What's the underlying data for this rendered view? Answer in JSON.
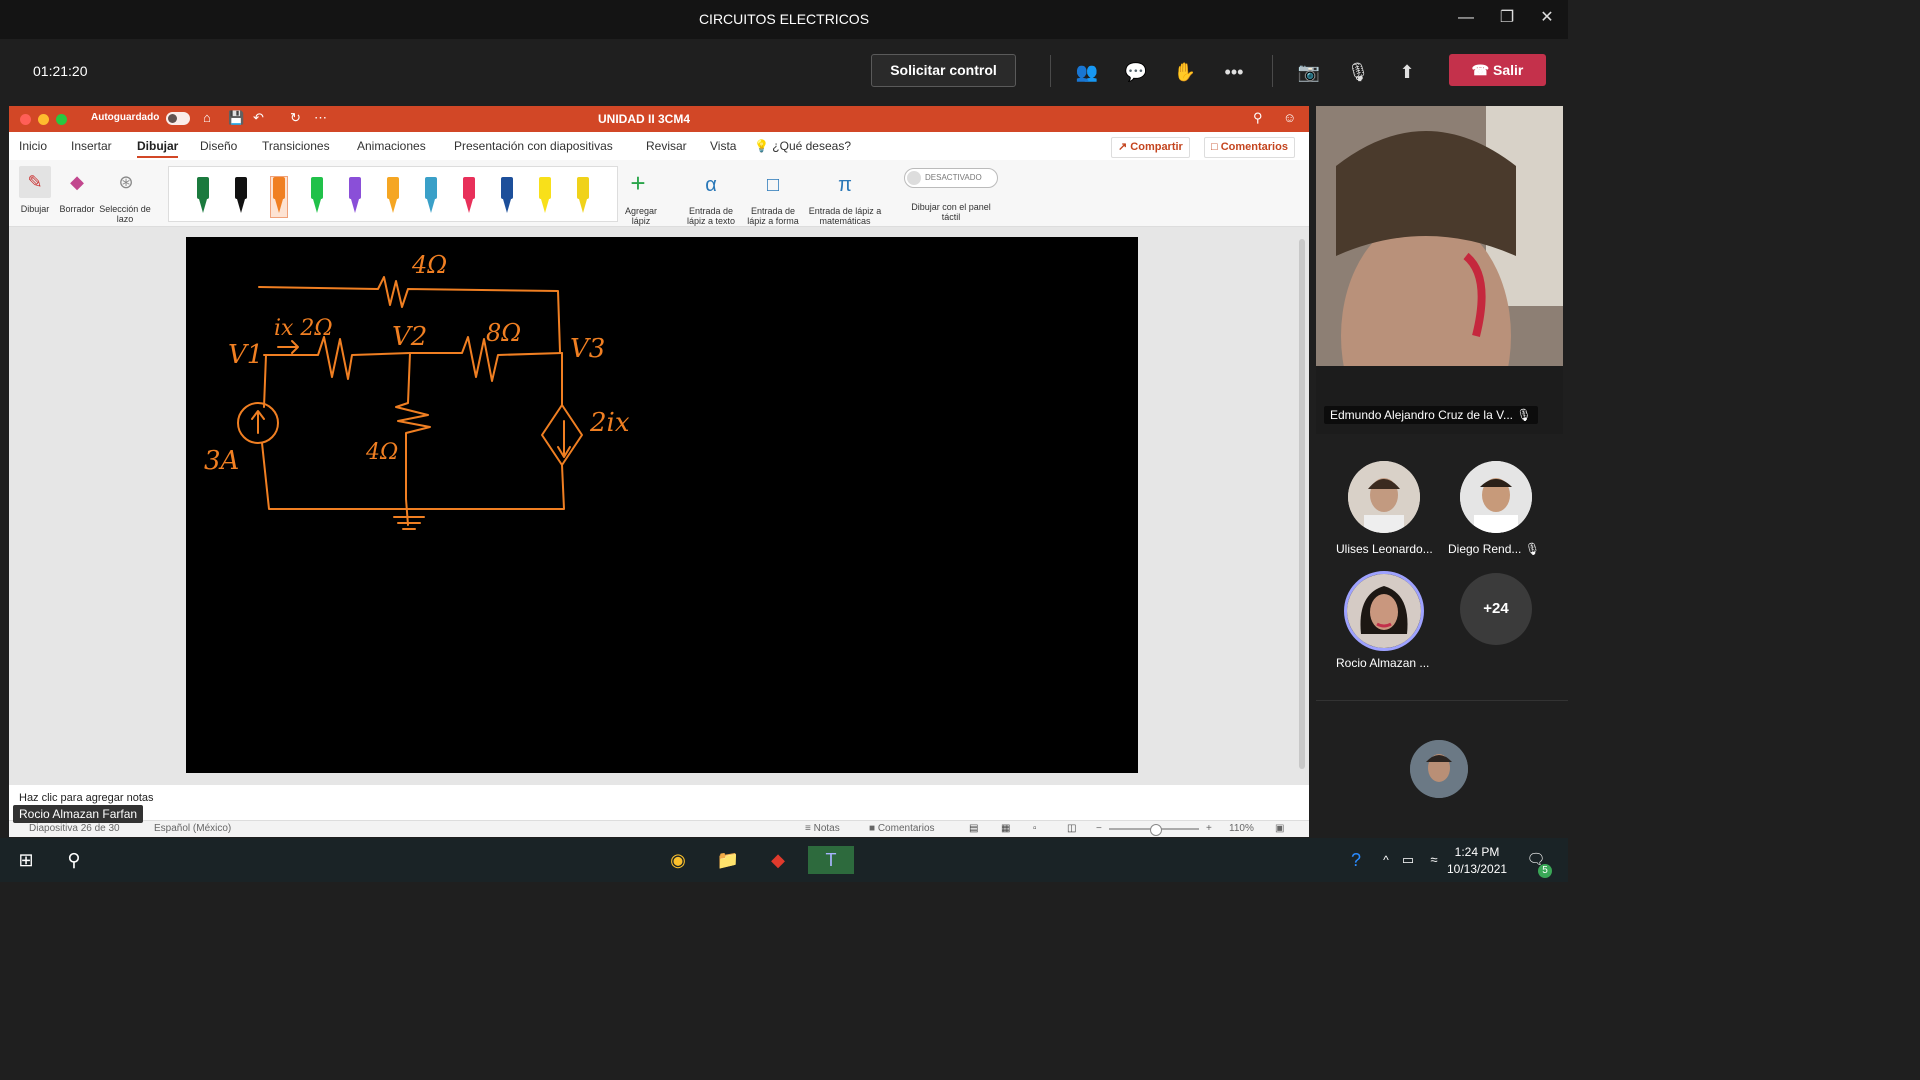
{
  "window": {
    "title": "CIRCUITOS ELECTRICOS"
  },
  "call": {
    "timer": "01:21:20",
    "request_control": "Solicitar control",
    "leave": "Salir"
  },
  "ppt": {
    "autosave_label": "Autoguardado",
    "autosave_state": "o",
    "doc_name": "UNIDAD II 3CM4",
    "tabs": [
      "Inicio",
      "Insertar",
      "Dibujar",
      "Diseño",
      "Transiciones",
      "Animaciones",
      "Presentación con diapositivas",
      "Revisar",
      "Vista"
    ],
    "active_tab": "Dibujar",
    "tell_me": "¿Qué deseas?",
    "share": "Compartir",
    "comments": "Comentarios",
    "ribbon": {
      "draw": "Dibujar",
      "eraser": "Borrador",
      "lasso": "Selección de lazo",
      "add_pen": "Agregar lápiz",
      "ink_text": "Entrada de lápiz a texto",
      "ink_shape": "Entrada de lápiz a forma",
      "ink_math": "Entrada de lápiz a matemáticas",
      "touch_toggle": "DESACTIVADO",
      "touch_label": "Dibujar con el panel táctil",
      "pen_colors": [
        "#1b7a3e",
        "#111111",
        "#f07f22",
        "#21c14a",
        "#8a4fd8",
        "#f5a623",
        "#3aa0c8",
        "#e8305a",
        "#1d4f9a",
        "#f8e01a",
        "#f0d21a"
      ]
    },
    "slide": {
      "labels": {
        "r_top": "4Ω",
        "ix2": "ix 2Ω",
        "v1": "V1",
        "v2": "V2",
        "r8": "8Ω",
        "v3": "V3",
        "src3": "3A",
        "r4": "4Ω",
        "dep": "2ix"
      },
      "ink_color": "#f07f22"
    },
    "notes_placeholder": "Haz clic para agregar notas",
    "status": {
      "slide": "Diapositiva 26 de 30",
      "lang": "Español (México)",
      "notes": "Notas",
      "comments": "Comentarios",
      "zoom": "110%"
    },
    "presenter": "Rocio Almazan Farfan"
  },
  "participants": {
    "video_name": "Edmundo Alejandro Cruz de la V...",
    "list": [
      {
        "name": "Ulises Leonardo..."
      },
      {
        "name": "Diego Rend..."
      },
      {
        "name": "Rocio Almazan ..."
      },
      {
        "name": "+24"
      }
    ]
  },
  "taskbar": {
    "time": "1:24 PM",
    "date": "10/13/2021",
    "notif_count": "5"
  }
}
